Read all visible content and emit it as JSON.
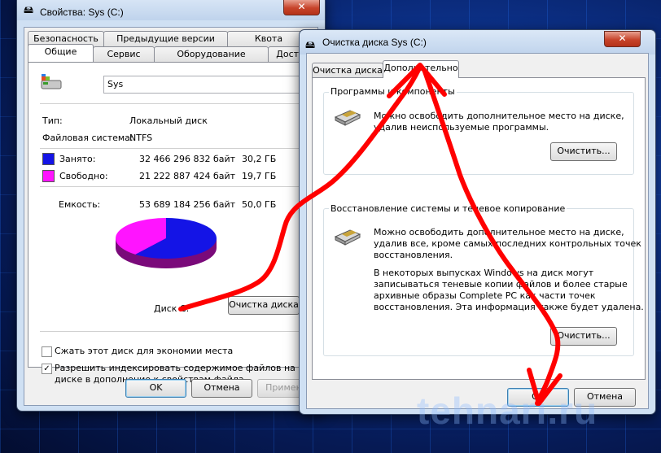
{
  "colors": {
    "used": "#1414e6",
    "free": "#ff14ff",
    "arrow": "#ff0000",
    "accent": "#3c7fb1"
  },
  "props": {
    "title": "Свойства: Sys (C:)",
    "close": "✕",
    "tabs_top": [
      "Безопасность",
      "Предыдущие версии",
      "Квота"
    ],
    "tabs_bottom": [
      "Общие",
      "Сервис",
      "Оборудование",
      "Доступ"
    ],
    "name_value": "Sys",
    "type_label": "Тип:",
    "type_value": "Локальный диск",
    "fs_label": "Файловая система:",
    "fs_value": "NTFS",
    "used_label": "Занято:",
    "used_bytes": "32 466 296 832 байт",
    "used_gb": "30,2 ГБ",
    "free_label": "Свободно:",
    "free_bytes": "21 222 887 424 байт",
    "free_gb": "19,7 ГБ",
    "cap_label": "Емкость:",
    "cap_bytes": "53 689 184 256 байт",
    "cap_gb": "50,0 ГБ",
    "disk_label": "Диск C:",
    "cleanup_btn": "Очистка диска",
    "compress_label": "Сжать этот диск для экономии места",
    "index_label_1": "Разрешить индексировать содержимое файлов на этом",
    "index_label_2": "диске в дополнение к свойствам файла",
    "ok": "OK",
    "cancel": "Отмена",
    "apply": "Примени",
    "used_fraction": 0.604
  },
  "cleanup": {
    "title": "Очистка диска Sys (C:)",
    "close": "✕",
    "tabs": [
      "Очистка диска",
      "Дополнительно"
    ],
    "g1_title": "Программы и компоненты",
    "g1_text_1": "Можно освободить дополнительное место на диске,",
    "g1_text_2": "удалив неиспользуемые программы.",
    "g1_btn": "Очистить...",
    "g2_title": "Восстановление системы и теневое копирование",
    "g2_text_1": "Можно освободить дополнительное место на диске,",
    "g2_text_2": "удалив все, кроме самых последних контрольных точек",
    "g2_text_3": "восстановления.",
    "g2_text_4": "В некоторых выпусках Windows на диск могут",
    "g2_text_5": "записываться теневые копии файлов и более старые",
    "g2_text_6": "архивные образы Complete PC как части точек",
    "g2_text_7": "восстановления. Эта информация также будет удалена.",
    "g2_btn": "Очистить...",
    "ok": "OK",
    "cancel": "Отмена"
  },
  "watermark": "tehnari.ru"
}
